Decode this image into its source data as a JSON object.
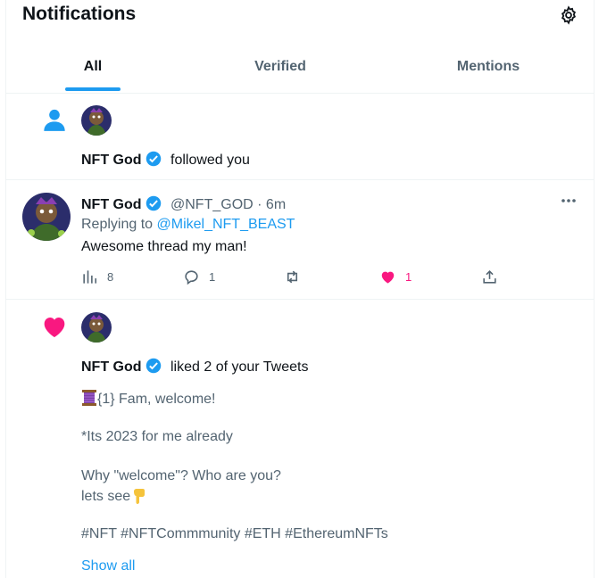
{
  "header": {
    "title": "Notifications",
    "settings_icon": "gear-icon"
  },
  "tabs": [
    {
      "label": "All",
      "active": true
    },
    {
      "label": "Verified",
      "active": false
    },
    {
      "label": "Mentions",
      "active": false
    }
  ],
  "follow_notification": {
    "icon": "person-icon",
    "user_name": "NFT God",
    "action": "followed you"
  },
  "reply_tweet": {
    "user_name": "NFT God",
    "handle": "@NFT_GOD",
    "separator": "·",
    "time": "6m",
    "replying_prefix": "Replying to",
    "replying_to": "@Mikel_NFT_BEAST",
    "text": "Awesome thread my man!",
    "stats": {
      "views": "8",
      "replies": "1",
      "retweets": "",
      "likes": "1"
    },
    "like_color": "#f91880"
  },
  "like_notification": {
    "icon": "heart-icon",
    "user_name": "NFT God",
    "action": "liked 2 of your Tweets",
    "tweet_line1": "{1} Fam, welcome!",
    "tweet_line2": "*Its 2023 for me already",
    "tweet_line3": "Why \"welcome\"? Who are you?",
    "tweet_line4": "lets see",
    "tweet_line5": "#NFT #NFTCommmunity #ETH #EthereumNFTs",
    "show_all": "Show all"
  },
  "colors": {
    "accent": "#1d9bf0",
    "like": "#f91880",
    "text": "#0f1419",
    "muted": "#536471"
  }
}
